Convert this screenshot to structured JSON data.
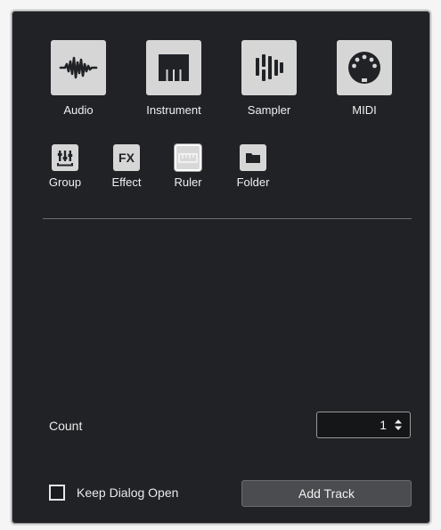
{
  "track_types": {
    "audio": {
      "label": "Audio",
      "icon": "waveform-icon"
    },
    "instrument": {
      "label": "Instrument",
      "icon": "piano-keys-icon"
    },
    "sampler": {
      "label": "Sampler",
      "icon": "sampler-bars-icon"
    },
    "midi": {
      "label": "MIDI",
      "icon": "midi-connector-icon"
    }
  },
  "small_types": {
    "group": {
      "label": "Group",
      "icon": "group-faders-icon"
    },
    "effect": {
      "label": "Effect",
      "icon_text": "FX",
      "icon": "fx-icon"
    },
    "ruler": {
      "label": "Ruler",
      "icon": "ruler-icon",
      "selected": true
    },
    "folder": {
      "label": "Folder",
      "icon": "folder-icon"
    }
  },
  "count": {
    "label": "Count",
    "value": "1"
  },
  "keep_dialog_open": {
    "label": "Keep Dialog Open",
    "checked": false
  },
  "add_track_button": {
    "label": "Add Track"
  },
  "colors": {
    "background": "#202226",
    "tile": "#d6d6d6",
    "button": "#4a4c50"
  }
}
